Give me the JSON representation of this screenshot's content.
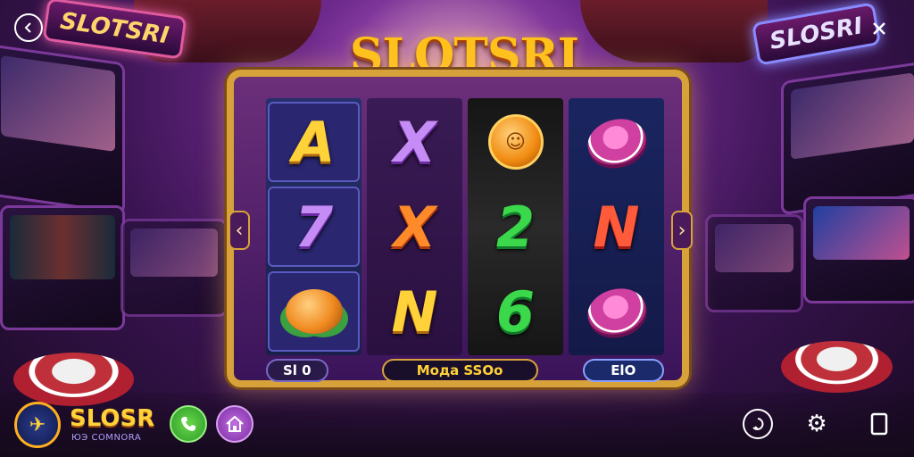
{
  "title": "SLOTSRI",
  "signs": {
    "left": "SLOTSRI",
    "right": "SLOSRI"
  },
  "reels": [
    [
      {
        "type": "letter",
        "label": "A",
        "color": "gold"
      },
      {
        "type": "letter",
        "label": "7",
        "color": "purple"
      },
      {
        "type": "fruit",
        "icon": "orange-fruit-icon"
      }
    ],
    [
      {
        "type": "letter",
        "label": "X",
        "color": "purple"
      },
      {
        "type": "letter",
        "label": "X",
        "color": "orange"
      },
      {
        "type": "letter",
        "label": "N",
        "color": "gold"
      }
    ],
    [
      {
        "type": "coin",
        "icon": "coin-icon"
      },
      {
        "type": "letter",
        "label": "2",
        "color": "green"
      },
      {
        "type": "letter",
        "label": "6",
        "color": "green"
      }
    ],
    [
      {
        "type": "chip",
        "icon": "chip-icon"
      },
      {
        "type": "letter",
        "label": "N",
        "color": "red"
      },
      {
        "type": "chip",
        "icon": "chip-icon"
      }
    ]
  ],
  "bottom_bar": {
    "bet": "Sl 0",
    "win": "Moдa SSOo",
    "credit": "ElO"
  },
  "logo": {
    "text": "SLOSR",
    "subtext": "ЮЭ COMNORA"
  },
  "colors": {
    "gold": "#ffd23a",
    "frame": "#d8a23a",
    "purple": "#6c2f7a"
  }
}
